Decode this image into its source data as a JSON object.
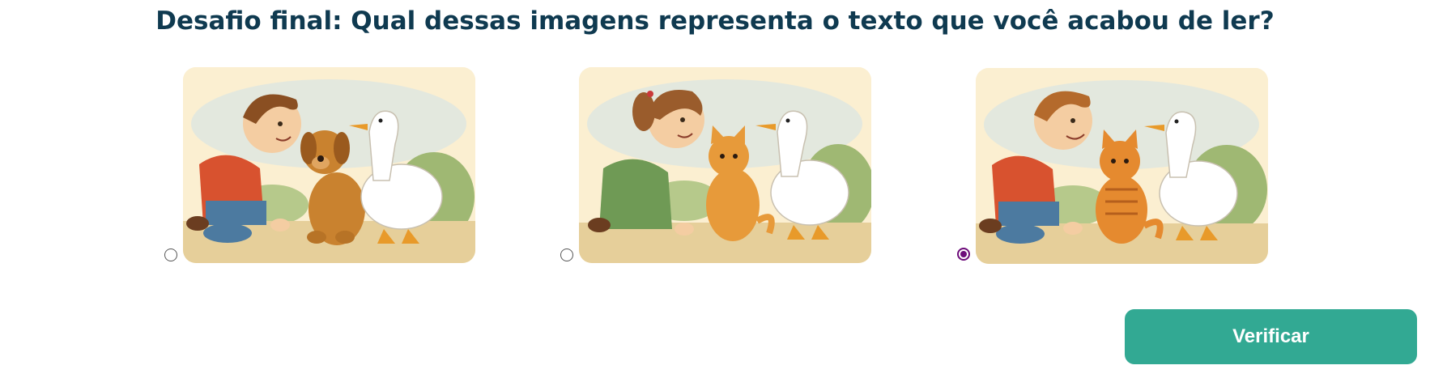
{
  "question": {
    "title": "Desafio final: Qual dessas imagens representa o texto que você acabou de ler?"
  },
  "options": [
    {
      "selected": false,
      "depicts": [
        "boy",
        "dog",
        "duck"
      ]
    },
    {
      "selected": false,
      "depicts": [
        "girl",
        "cat",
        "duck"
      ]
    },
    {
      "selected": true,
      "depicts": [
        "boy",
        "cat",
        "duck"
      ]
    }
  ],
  "actions": {
    "verify_label": "Verificar"
  },
  "colors": {
    "title": "#0f3a50",
    "verify_button": "#32a993",
    "radio_selected": "#6d0c7a",
    "card_background": "#fbefd1"
  }
}
